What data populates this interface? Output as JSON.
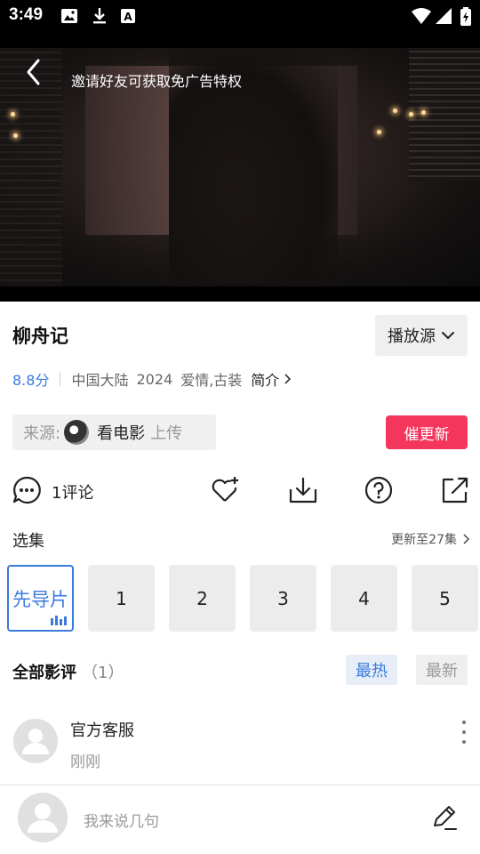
{
  "status_bar": {
    "time": "3:49"
  },
  "player": {
    "invite_text": "邀请好友可获取免广告特权"
  },
  "show": {
    "title": "柳舟记",
    "source_button_label": "播放源",
    "rating": "8.8分",
    "region": "中国大陆",
    "year": "2024",
    "genres": "爱情,古装",
    "intro_label": "简介"
  },
  "uploader": {
    "prefix": "来源:",
    "name": "看电影",
    "suffix": "上传"
  },
  "urge_update_label": "催更新",
  "actions": {
    "comments_label": "1评论"
  },
  "episodes": {
    "section_title": "选集",
    "update_info": "更新至27集",
    "items": [
      "先导片",
      "1",
      "2",
      "3",
      "4",
      "5"
    ]
  },
  "reviews": {
    "title": "全部影评",
    "count": "（1）",
    "tab_hot": "最热",
    "tab_new": "最新",
    "items": [
      {
        "author": "官方客服",
        "time": "刚刚"
      }
    ]
  },
  "composer": {
    "placeholder": "我来说几句"
  },
  "colors": {
    "accent_blue": "#3b7bdc",
    "urge_red": "#f5365c"
  }
}
